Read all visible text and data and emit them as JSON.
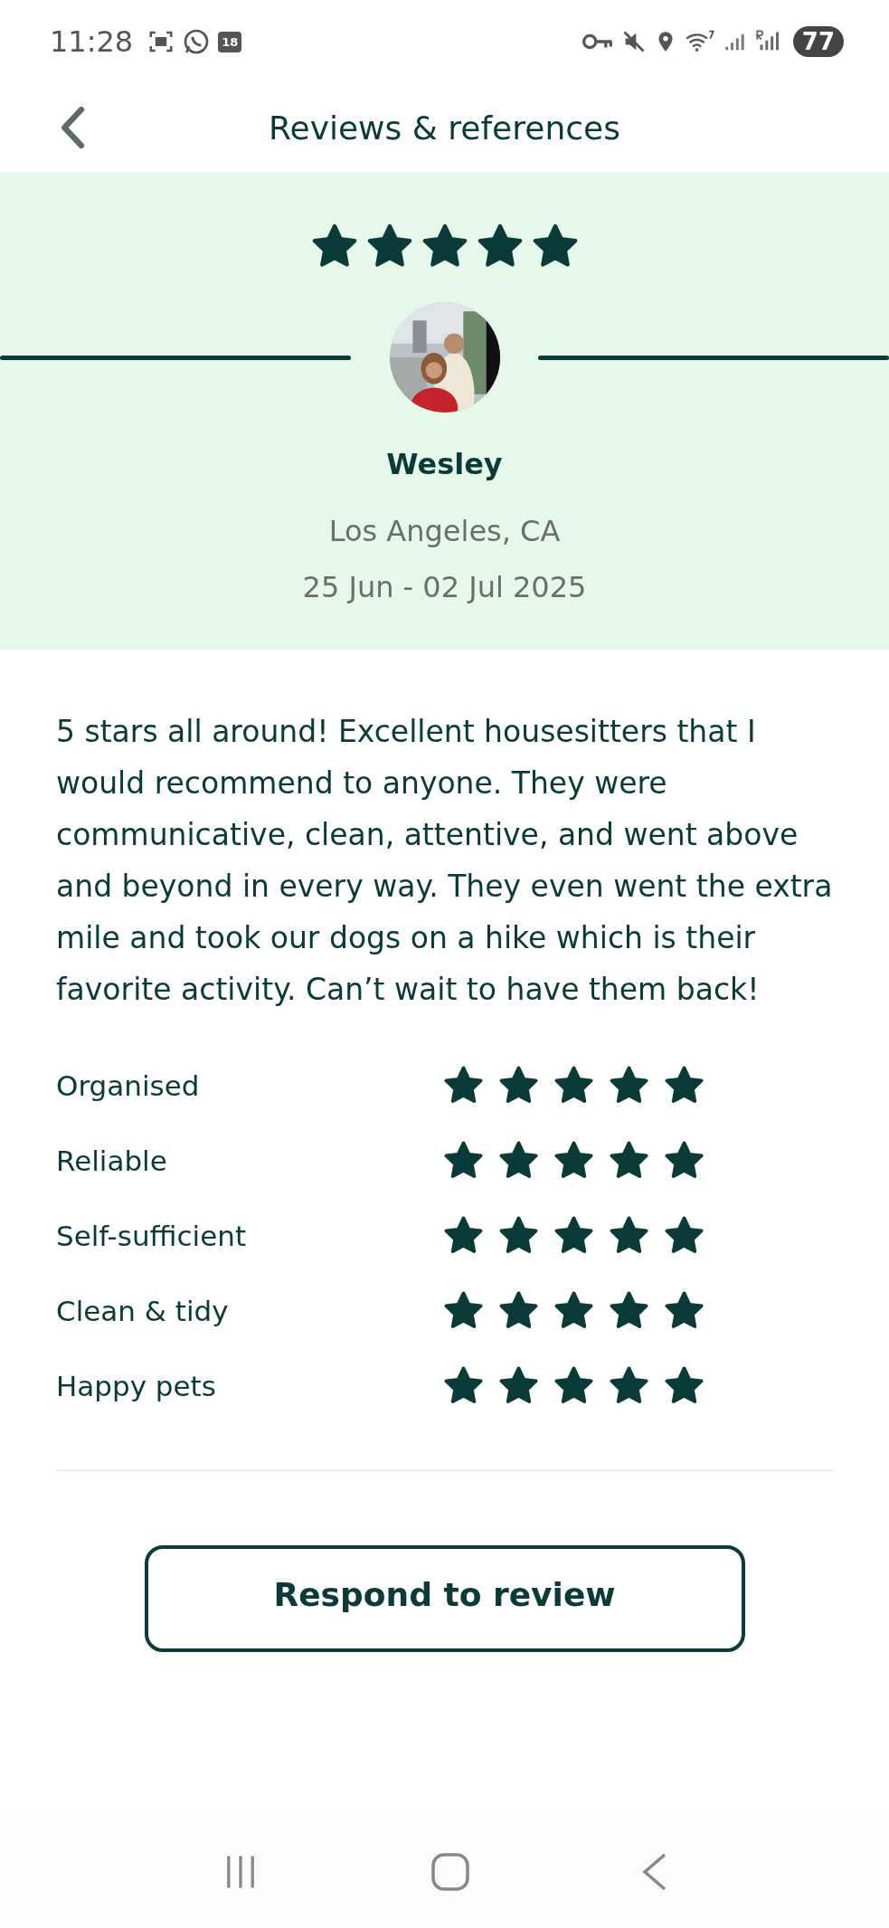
{
  "status_bar": {
    "time": "11:28",
    "calendar_badge": "18",
    "battery": "77"
  },
  "header": {
    "title": "Reviews & references"
  },
  "review": {
    "stars": 5,
    "name": "Wesley",
    "location": "Los Angeles, CA",
    "dates": "25 Jun - 02 Jul 2025",
    "text": "5 stars all around! Excellent housesitters that I would recommend to anyone. They were communicative, clean, attentive, and went above and beyond in every way. They even went the extra mile and took our dogs on a hike which is their favorite activity. Can’t wait to have them back!"
  },
  "ratings": [
    {
      "label": "Organised",
      "stars": 5
    },
    {
      "label": "Reliable",
      "stars": 5
    },
    {
      "label": "Self-sufficient",
      "stars": 5
    },
    {
      "label": "Clean & tidy",
      "stars": 5
    },
    {
      "label": "Happy pets",
      "stars": 5
    }
  ],
  "respond_button": {
    "label": "Respond to review"
  }
}
